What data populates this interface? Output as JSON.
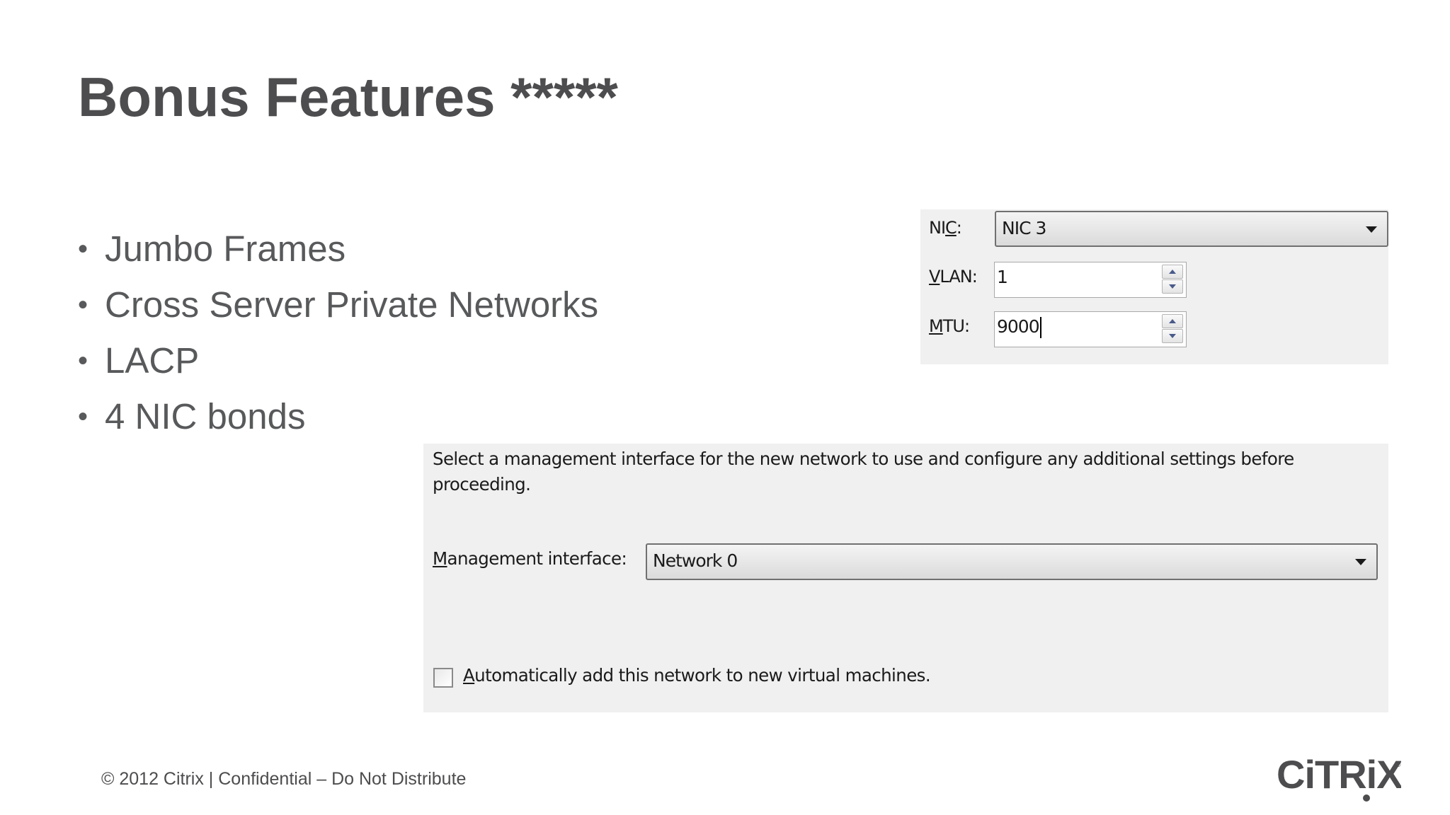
{
  "slide": {
    "title": "Bonus Features *****",
    "bullets": [
      "Jumbo Frames",
      "Cross Server Private Networks",
      "LACP",
      "4 NIC bonds"
    ],
    "bullet_symbol": "•"
  },
  "nic_dialog": {
    "nic_label_pre": "NI",
    "nic_label_key": "C",
    "nic_label_post": ":",
    "nic_value": "NIC 3",
    "vlan_label_key": "V",
    "vlan_label_post": "LAN:",
    "vlan_value": "1",
    "mtu_label_key": "M",
    "mtu_label_post": "TU:",
    "mtu_value": "9000"
  },
  "mgmt_dialog": {
    "description": "Select a management interface for the new network to use and configure any additional settings before proceeding.",
    "interface_label_key": "M",
    "interface_label_post": "anagement interface:",
    "interface_value": "Network 0",
    "auto_add_checked": false,
    "auto_add_label_key": "A",
    "auto_add_label_post": "utomatically add this network to new virtual machines."
  },
  "footer": {
    "text": "© 2012 Citrix | Confidential – Do Not Distribute"
  },
  "logo": {
    "text": "CiTRiX",
    "registered": "®",
    "color": "#4d4d4f"
  }
}
